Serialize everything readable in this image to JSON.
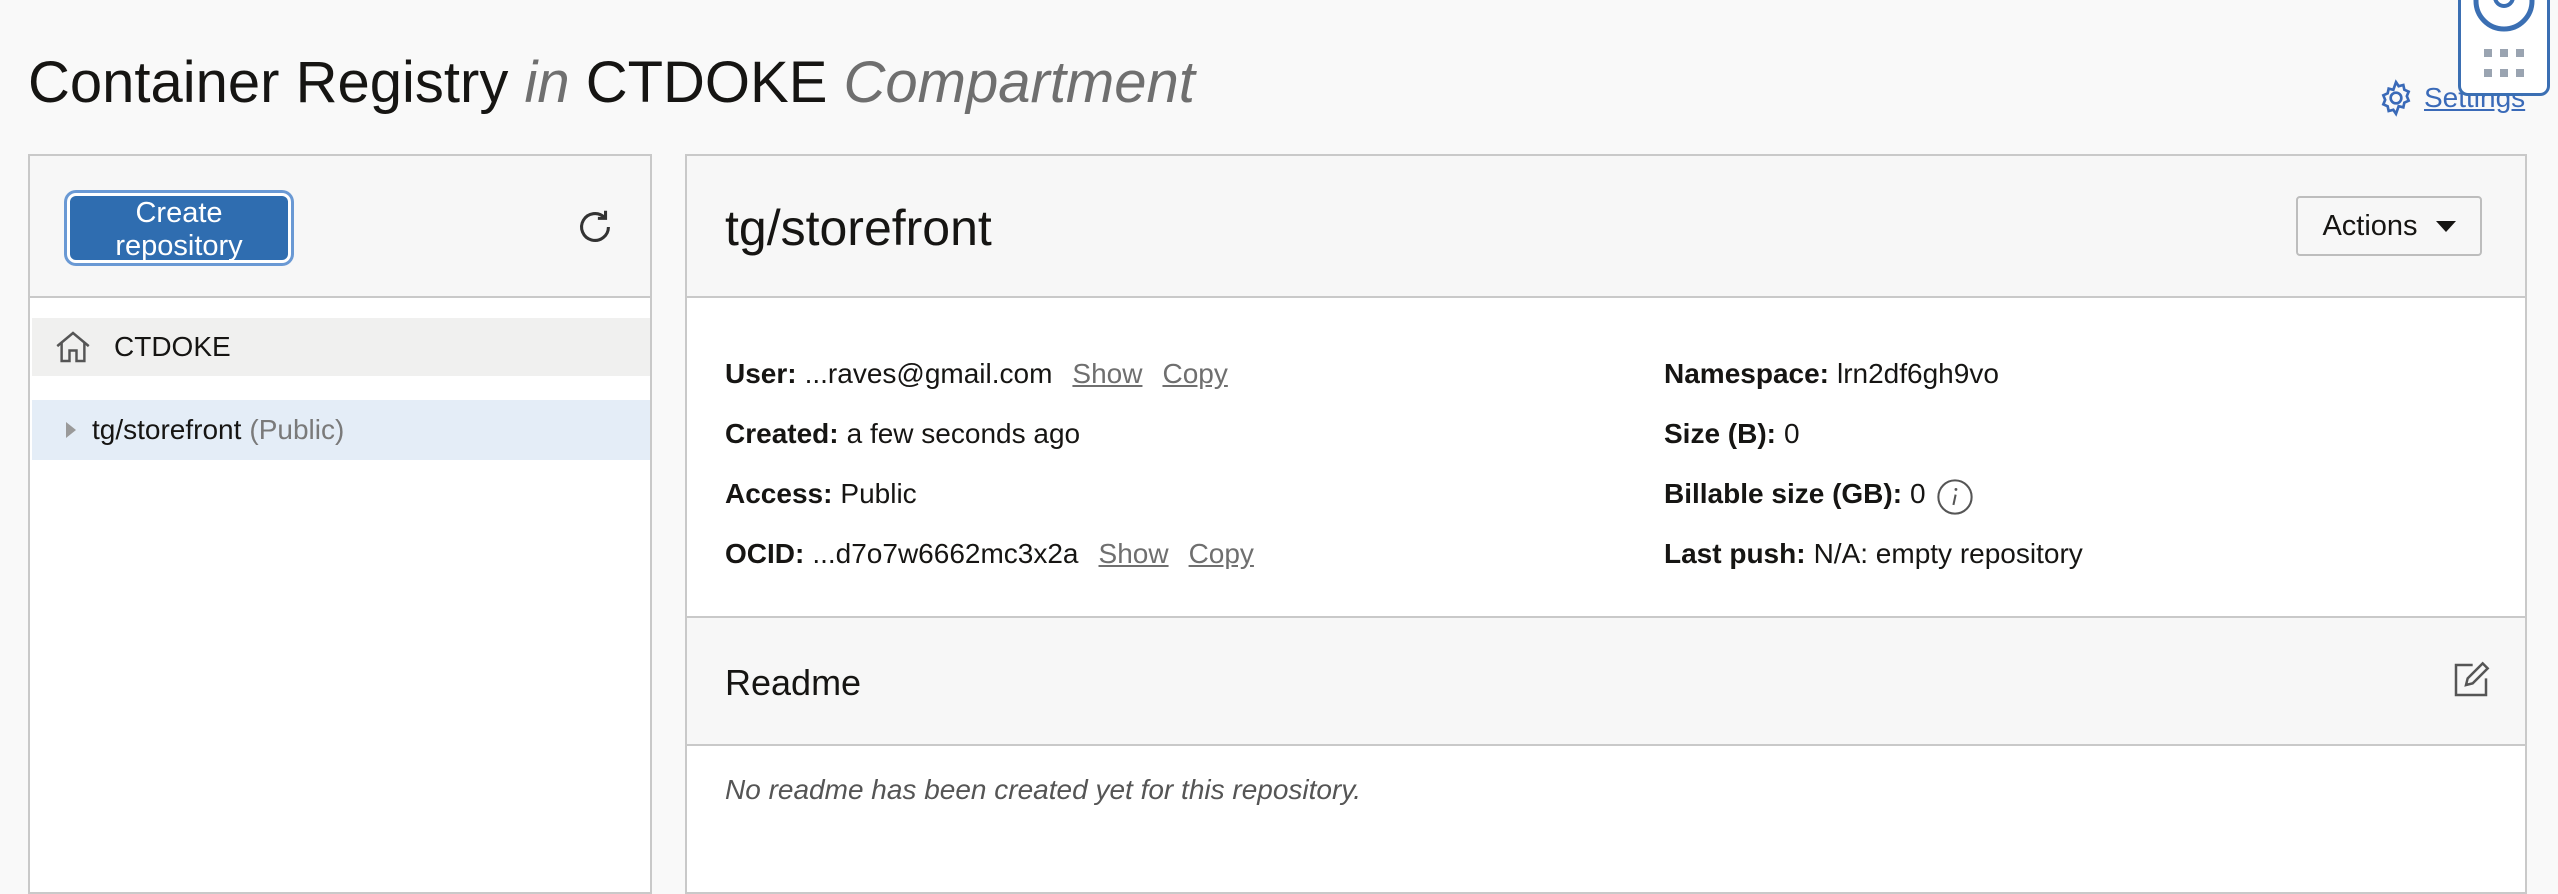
{
  "header": {
    "title_main": "Container Registry",
    "title_in": "in",
    "title_compartment": "CTDOKE",
    "title_suffix": "Compartment",
    "settings_label": "Settings"
  },
  "left_panel": {
    "create_button": "Create repository",
    "tree_root": "CTDOKE",
    "repos": [
      {
        "name": "tg/storefront",
        "visibility": "(Public)"
      }
    ]
  },
  "repo": {
    "title": "tg/storefront",
    "actions_label": "Actions",
    "details_left": [
      {
        "label": "User:",
        "value": "...raves@gmail.com",
        "show": "Show",
        "copy": "Copy"
      },
      {
        "label": "Created:",
        "value": "a few seconds ago"
      },
      {
        "label": "Access:",
        "value": "Public"
      },
      {
        "label": "OCID:",
        "value": "...d7o7w6662mc3x2a",
        "show": "Show",
        "copy": "Copy"
      }
    ],
    "details_right": [
      {
        "label": "Namespace:",
        "value": "lrn2df6gh9vo"
      },
      {
        "label": "Size (B):",
        "value": "0"
      },
      {
        "label": "Billable size (GB):",
        "value": "0"
      },
      {
        "label": "Last push:",
        "value": "N/A: empty repository"
      }
    ]
  },
  "readme": {
    "title": "Readme",
    "empty_text": "No readme has been created yet for this repository."
  },
  "icons": {
    "settings": "gear-icon",
    "refresh": "refresh-icon",
    "home": "home-icon",
    "info": "info-icon",
    "edit": "edit-icon",
    "help": "help-icon",
    "apps": "grid-icon"
  },
  "colors": {
    "accent": "#2f6db0",
    "link": "#3a6ab8",
    "selected_row": "#e4edf7"
  }
}
